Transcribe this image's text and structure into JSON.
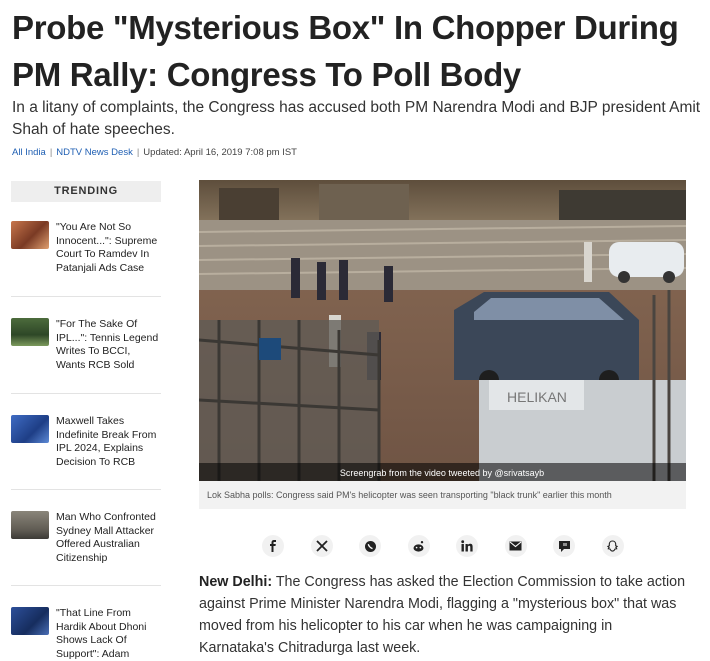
{
  "article": {
    "headline": "Probe \"Mysterious Box\" In Chopper During PM Rally: Congress To Poll Body",
    "summary": "In a litany of complaints, the Congress has accused both PM Narendra Modi and BJP president Amit Shah of hate speeches.",
    "meta": {
      "category": "All India",
      "author": "NDTV News Desk",
      "updated": "Updated: April 16, 2019 7:08 pm IST"
    },
    "media": {
      "overlay_text": "Screengrab from the video tweeted by @srivatsayb",
      "caption": "Lok Sabha polls: Congress said PM's helicopter was seen transporting \"black trunk\" earlier this month",
      "vehicle_text": "HELIKAN"
    },
    "body": {
      "dateline": "New Delhi:",
      "text": "The Congress has asked the Election Commission to take action against Prime Minister Narendra Modi, flagging a \"mysterious box\" that was moved from his helicopter to his car when he was campaigning in Karnataka's Chitradurga last week."
    }
  },
  "trending": {
    "heading": "TRENDING",
    "items": [
      {
        "text": "\"You Are Not So Innocent...\": Supreme Court To Ramdev In Patanjali Ads Case",
        "thumb_color": "#a15a3a"
      },
      {
        "text": "\"For The Sake Of IPL...\": Tennis Legend Writes To BCCI, Wants RCB Sold",
        "thumb_color": "#3a5a2e"
      },
      {
        "text": "Maxwell Takes Indefinite Break From IPL 2024, Explains Decision To RCB",
        "thumb_color": "#2a4f9a"
      },
      {
        "text": "Man Who Confronted Sydney Mall Attacker Offered Australian Citizenship",
        "thumb_color": "#6f6a60"
      },
      {
        "text": "\"That Line From Hardik About Dhoni Shows Lack Of Support\": Adam",
        "thumb_color": "#1f3f7a"
      }
    ]
  },
  "share": {
    "icons": [
      "facebook-icon",
      "x-icon",
      "whatsapp-icon",
      "reddit-icon",
      "linkedin-icon",
      "email-icon",
      "comment-icon",
      "snapchat-icon"
    ]
  },
  "colors": {
    "link": "#1f5fb3",
    "trending_bg": "#eeeeee",
    "caption_bg": "#f2f2f2"
  }
}
